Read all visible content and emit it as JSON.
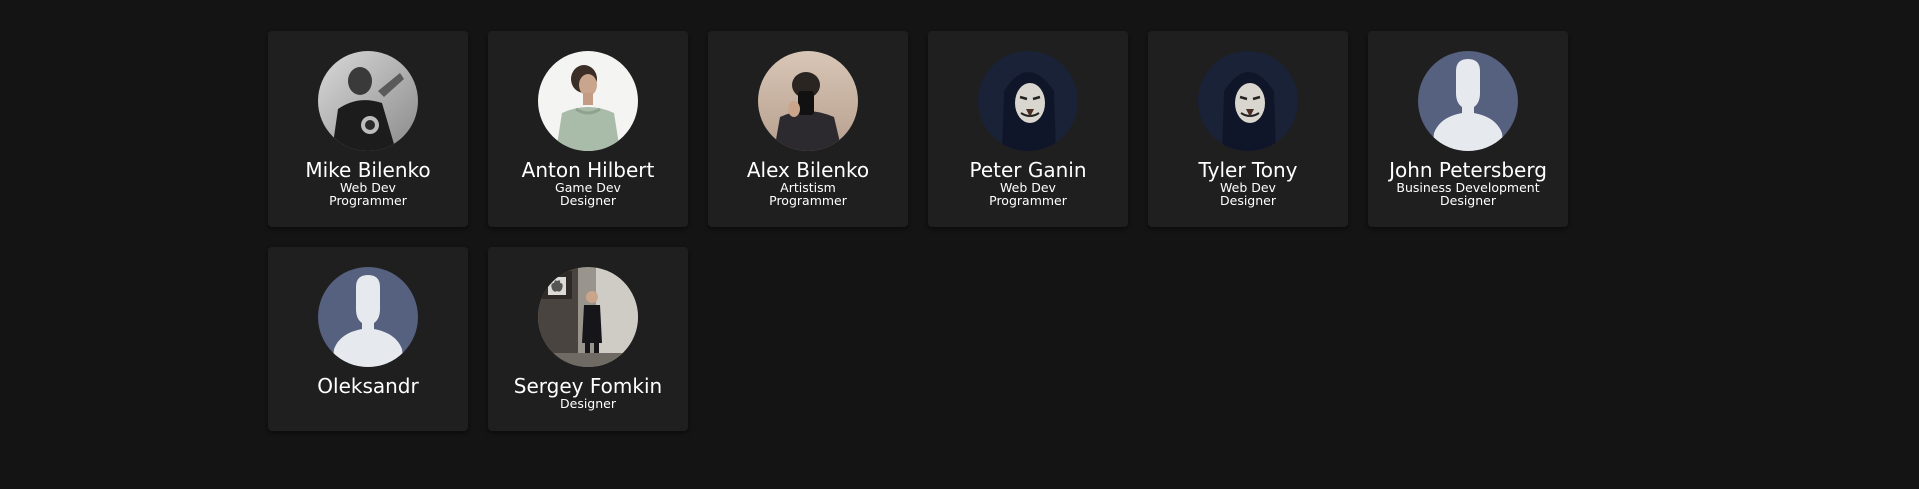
{
  "members": [
    {
      "name": "Mike Bilenko",
      "roles": [
        "Web Dev",
        "Programmer"
      ],
      "avatar_icon": "photo-man-in-black-tshirt"
    },
    {
      "name": "Anton Hilbert",
      "roles": [
        "Game Dev",
        "Designer"
      ],
      "avatar_icon": "photo-man-looking-up"
    },
    {
      "name": "Alex Bilenko",
      "roles": [
        "Artistism",
        "Programmer"
      ],
      "avatar_icon": "photo-mirror-selfie"
    },
    {
      "name": "Peter Ganin",
      "roles": [
        "Web Dev",
        "Programmer"
      ],
      "avatar_icon": "anonymous-mask-icon"
    },
    {
      "name": "Tyler Tony",
      "roles": [
        "Web Dev",
        "Designer"
      ],
      "avatar_icon": "anonymous-mask-icon"
    },
    {
      "name": "John Petersberg",
      "roles": [
        "Business Development",
        "Designer"
      ],
      "avatar_icon": "default-user-icon"
    },
    {
      "name": "Oleksandr",
      "roles": [],
      "avatar_icon": "default-user-icon"
    },
    {
      "name": "Sergey Fomkin",
      "roles": [
        "Designer"
      ],
      "avatar_icon": "photo-man-near-apple-store"
    }
  ],
  "colors": {
    "background": "#141414",
    "card": "#1f1f1f",
    "text": "#ffffff",
    "default_avatar_bg": "#56607f",
    "default_avatar_fg": "#e6e9ee"
  }
}
